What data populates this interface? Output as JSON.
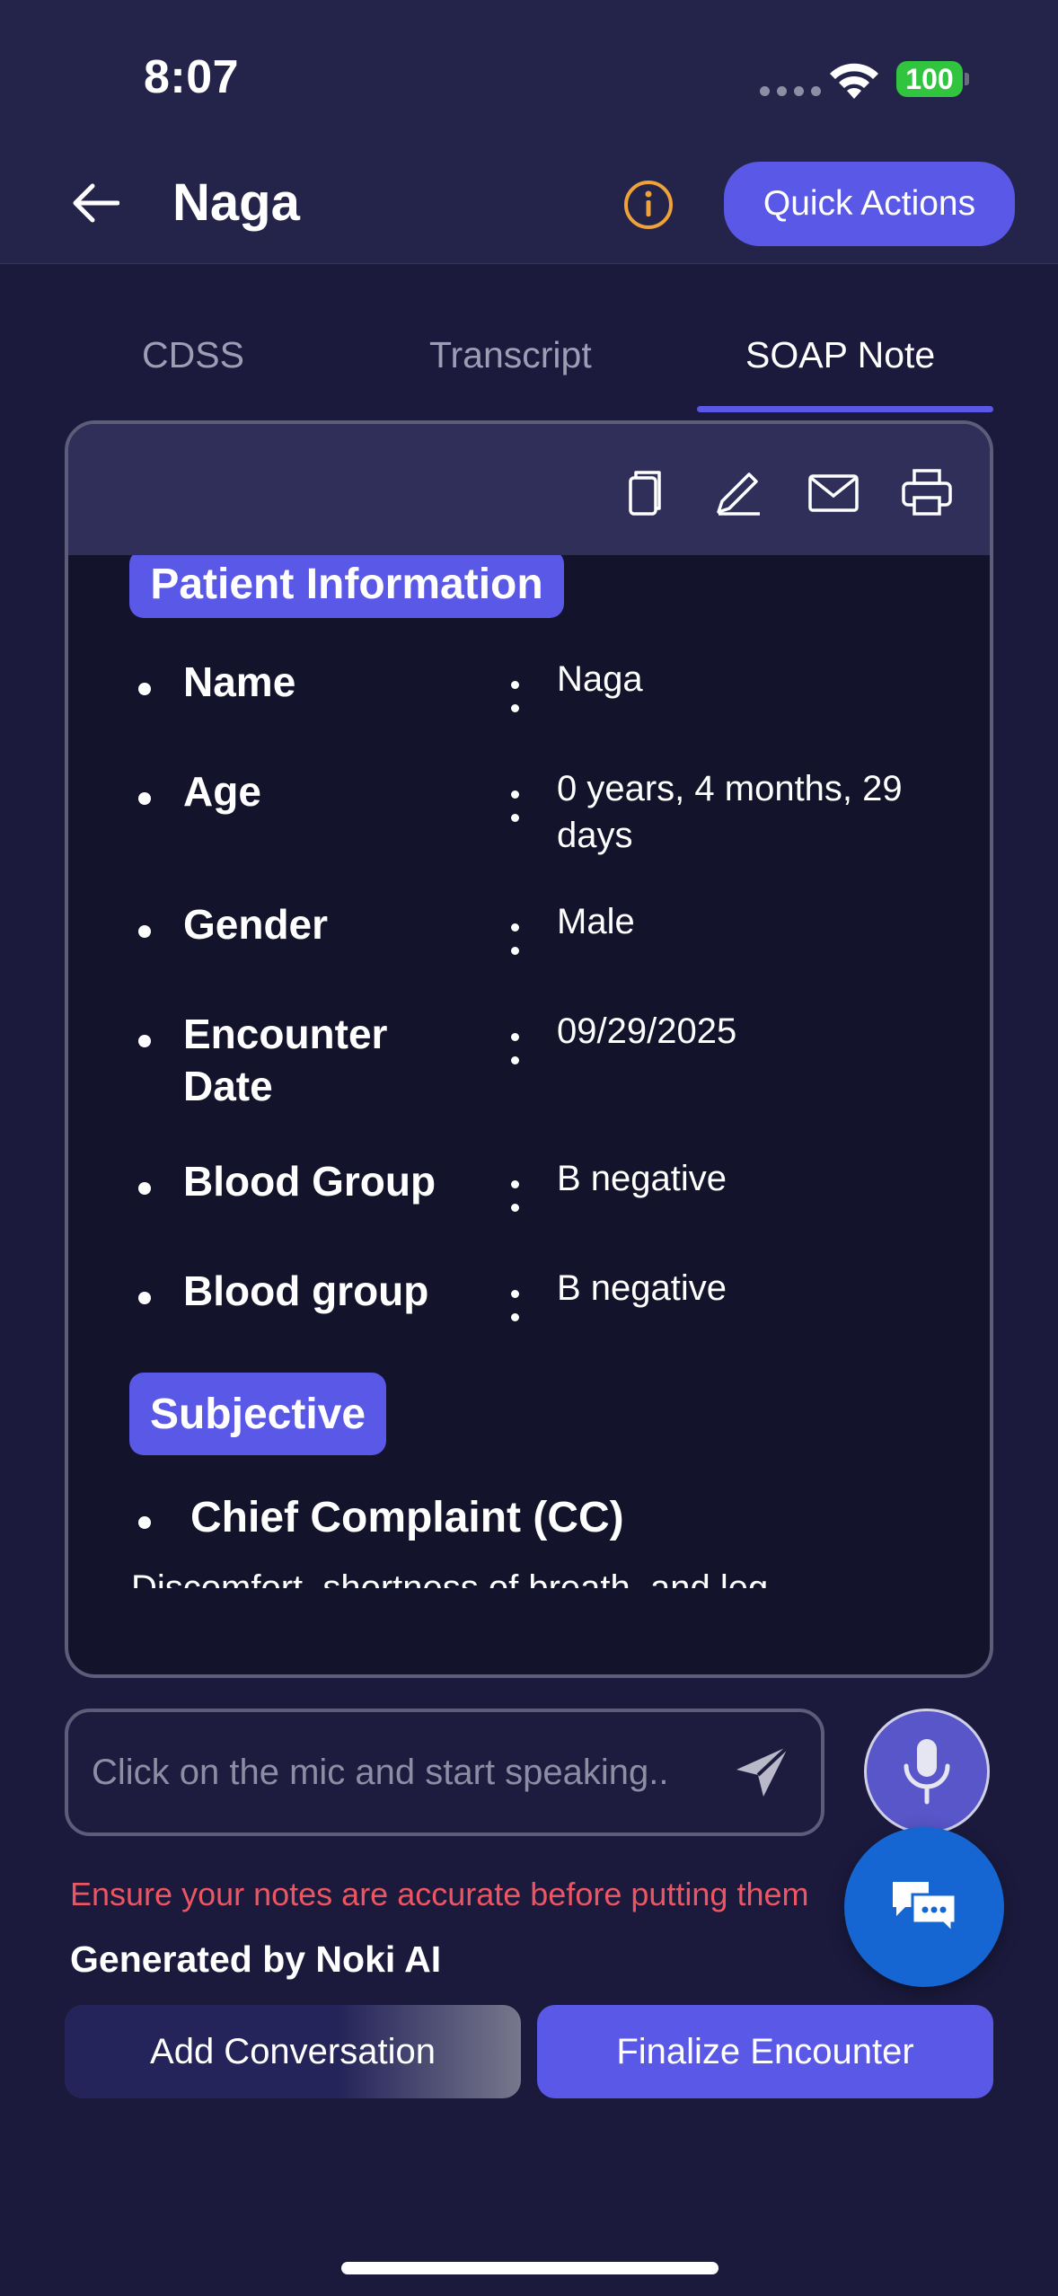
{
  "status_bar": {
    "time": "8:07",
    "battery": "100"
  },
  "header": {
    "title": "Naga",
    "quick_actions_label": "Quick Actions"
  },
  "tabs": [
    {
      "label": "CDSS",
      "active": false
    },
    {
      "label": "Transcript",
      "active": false
    },
    {
      "label": "SOAP Note",
      "active": true
    }
  ],
  "soap_note": {
    "toolbar_icons": [
      "copy-icon",
      "edit-icon",
      "mail-icon",
      "print-icon"
    ],
    "patient_info_title": "Patient Information",
    "patient_rows": [
      {
        "label": "Name",
        "value": "Naga"
      },
      {
        "label": "Age",
        "value": "0 years, 4 months, 29 days"
      },
      {
        "label": "Gender",
        "value": "Male"
      },
      {
        "label": "Encounter Date",
        "value": "09/29/2025"
      },
      {
        "label": "Blood Group",
        "value": "B negative"
      },
      {
        "label": "Blood group",
        "value": "B negative"
      }
    ],
    "subjective_title": "Subjective",
    "chief_complaint_label": "Chief Complaint (CC)",
    "chief_complaint_text": "Discomfort, shortness of breath, and leg"
  },
  "composer": {
    "placeholder": "Click on the mic and start speaking.."
  },
  "warning_text": "Ensure your notes are accurate before putting them",
  "generated_by": "Generated by Noki AI",
  "actions": {
    "add_conversation": "Add Conversation",
    "finalize_encounter": "Finalize Encounter"
  },
  "colors": {
    "accent": "#5a58e6",
    "background": "#1b1a3d",
    "warning": "#ec5562",
    "fab": "#1566d3"
  }
}
